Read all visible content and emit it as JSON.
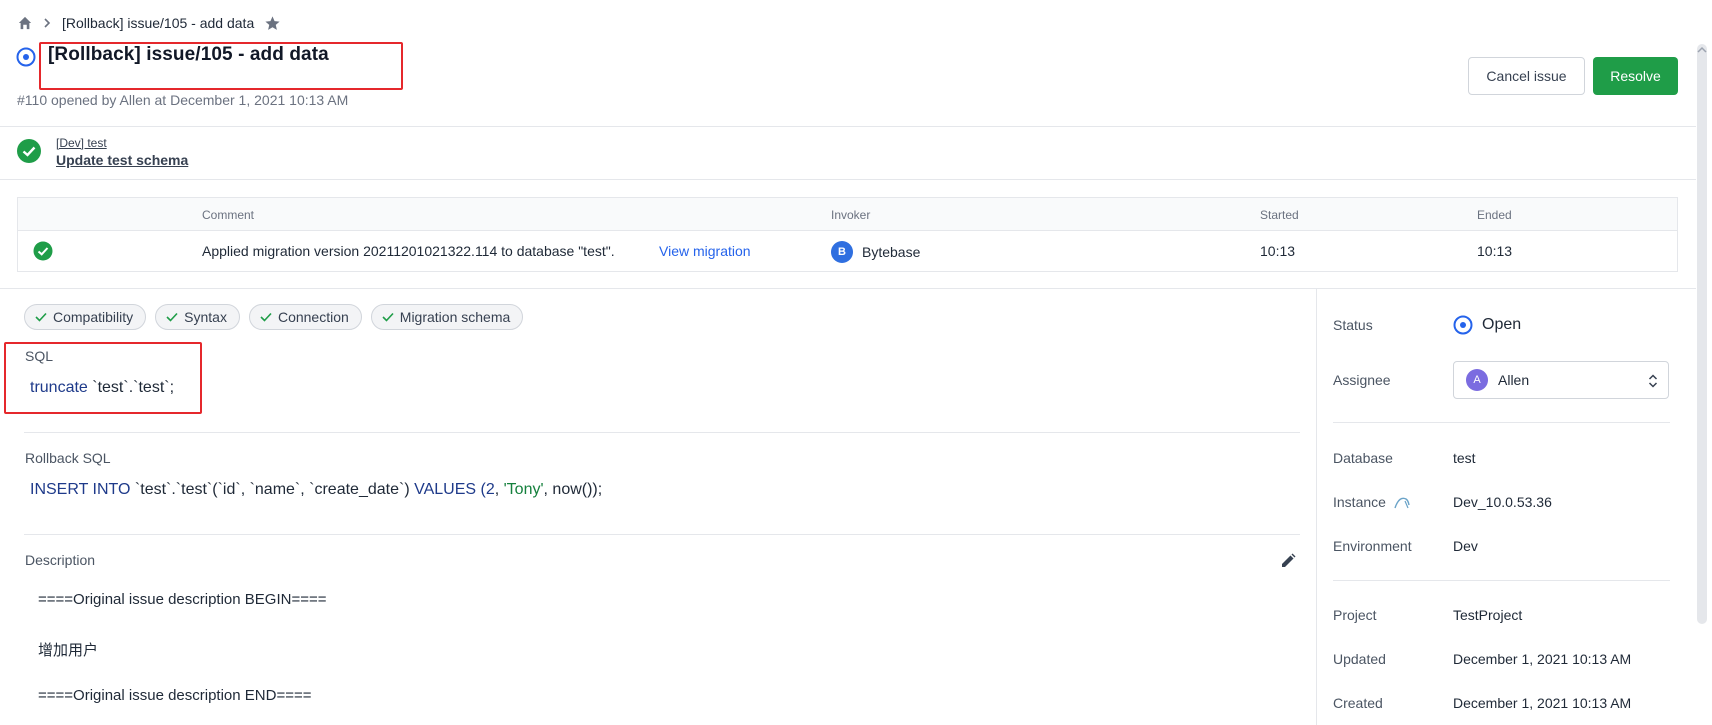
{
  "breadcrumb": {
    "current": "[Rollback] issue/105 - add data"
  },
  "issue": {
    "title": "[Rollback] issue/105 - add data",
    "subtitle": "#110 opened by Allen at December 1, 2021 10:13 AM"
  },
  "actions": {
    "cancel_label": "Cancel issue",
    "resolve_label": "Resolve"
  },
  "stage": {
    "env": "[Dev] test",
    "name": "Update test schema"
  },
  "task_table": {
    "headers": {
      "comment": "Comment",
      "invoker": "Invoker",
      "started": "Started",
      "ended": "Ended"
    },
    "row": {
      "comment": "Applied migration version 20211201021322.114 to database \"test\".",
      "link": "View migration",
      "invoker_initial": "B",
      "invoker": "Bytebase",
      "started": "10:13",
      "ended": "10:13"
    }
  },
  "checks": [
    "Compatibility",
    "Syntax",
    "Connection",
    "Migration schema"
  ],
  "sql": {
    "label": "SQL"
  },
  "rollback": {
    "label": "Rollback SQL"
  },
  "description": {
    "label": "Description",
    "lines": [
      "====Original issue description BEGIN====",
      "增加用户",
      "====Original issue description END===="
    ]
  },
  "sidebar": {
    "status_label": "Status",
    "status_value": "Open",
    "assignee_label": "Assignee",
    "assignee_initial": "A",
    "assignee_value": "Allen",
    "database_label": "Database",
    "database_value": "test",
    "instance_label": "Instance",
    "instance_value": "Dev_10.0.53.36",
    "environment_label": "Environment",
    "environment_value": "Dev",
    "project_label": "Project",
    "project_value": "TestProject",
    "updated_label": "Updated",
    "updated_value": "December 1, 2021 10:13 AM",
    "created_label": "Created",
    "created_value": "December 1, 2021 10:13 AM"
  },
  "colors": {
    "accent": "#1f9d48",
    "link": "#2563eb",
    "highlight": "#e5282c",
    "status_ring": "#2563eb"
  }
}
